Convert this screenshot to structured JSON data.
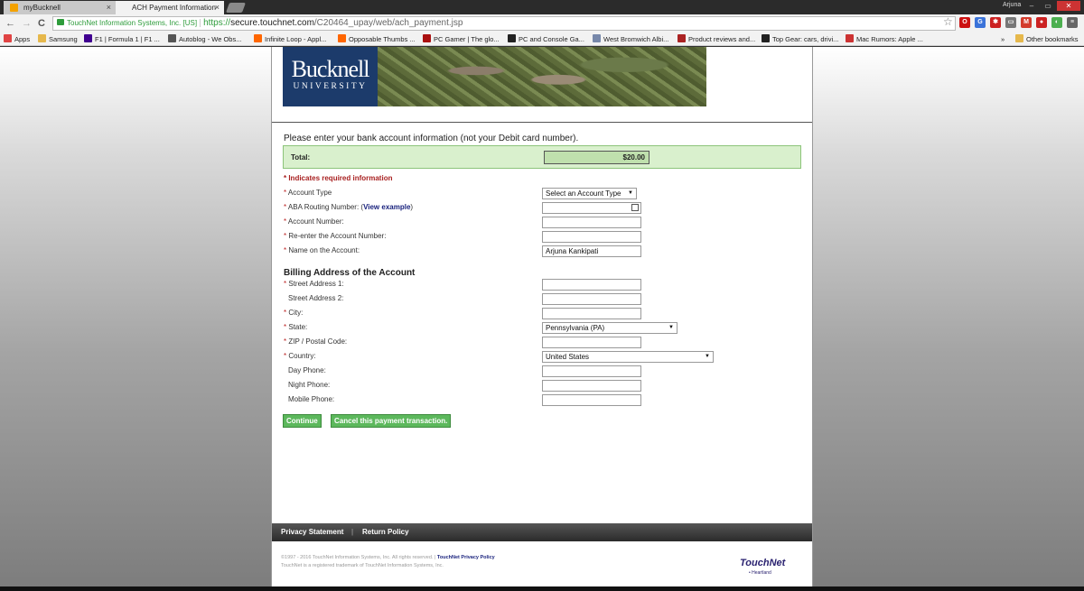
{
  "browser": {
    "tabs": [
      {
        "label": "myBucknell",
        "active": false
      },
      {
        "label": "ACH Payment Information",
        "active": true
      }
    ],
    "tab_close_glyph": "×",
    "user": "Arjuna",
    "window_controls": [
      "–",
      "▭",
      "✕"
    ],
    "nav_glyphs": {
      "back": "←",
      "forward": "→",
      "reload": "C"
    },
    "ev_cert": "TouchNet Information Systems, Inc. [US]",
    "url_scheme": "https://",
    "url_host": "secure.touchnet.com",
    "url_path": "/C20464_upay/web/ach_payment.jsp",
    "star_glyph": "☆",
    "extensions": [
      {
        "icon": "opera-icon",
        "color": "#cc1111",
        "glyph": "O"
      },
      {
        "icon": "translate-icon",
        "color": "#3b73d9",
        "glyph": "G"
      },
      {
        "icon": "lastpass-icon",
        "color": "#cc2222",
        "glyph": "✱"
      },
      {
        "icon": "cast-icon",
        "color": "#777777",
        "glyph": "▭"
      },
      {
        "icon": "gmail-icon",
        "color": "#d33b2c",
        "glyph": "M"
      },
      {
        "icon": "chrome-remote-icon",
        "color": "#cc2222",
        "glyph": "●"
      },
      {
        "icon": "pushbullet-icon",
        "color": "#4caf50",
        "glyph": "◐"
      },
      {
        "icon": "menu-icon",
        "color": "#666666",
        "glyph": "≡"
      }
    ],
    "bookmarks": [
      {
        "label": "Apps",
        "color": "#e04444"
      },
      {
        "label": "Samsung",
        "color": "#e6b84c"
      },
      {
        "label": "F1 | Formula 1 | F1 ...",
        "color": "#400090"
      },
      {
        "label": "Autoblog - We Obs...",
        "color": "#555555"
      },
      {
        "label": "Infinite Loop - Appl...",
        "color": "#ff6600"
      },
      {
        "label": "Opposable Thumbs ...",
        "color": "#ff6600"
      },
      {
        "label": "PC Gamer | The glo...",
        "color": "#aa1111"
      },
      {
        "label": "PC and Console Ga...",
        "color": "#222222"
      },
      {
        "label": "West Bromwich Albi...",
        "color": "#7788aa"
      },
      {
        "label": "Product reviews and...",
        "color": "#aa2222"
      },
      {
        "label": "Top Gear: cars, drivi...",
        "color": "#222222"
      },
      {
        "label": "Mac Rumors: Apple ...",
        "color": "#cc3333"
      }
    ],
    "bookmarks_more": "»",
    "other_bookmarks": "Other bookmarks"
  },
  "banner": {
    "logo_line1": "Bucknell",
    "logo_line2": "UNIVERSITY"
  },
  "form": {
    "intro": "Please enter your bank account information (not your Debit card number).",
    "total_label": "Total:",
    "total_value": "$20.00",
    "required_note": "* Indicates required information",
    "required_mark": "*",
    "account_type_label": "Account Type",
    "account_type_value": "Select an Account Type",
    "routing_label": "ABA Routing Number:",
    "routing_link": "View example",
    "routing_value": "",
    "account_number_label": "Account Number:",
    "account_number_value": "",
    "reenter_label": "Re-enter the Account Number:",
    "reenter_value": "",
    "name_label": "Name on the Account:",
    "name_value": "Arjuna Kankipati",
    "billing_heading": "Billing Address of the Account",
    "street1_label": "Street Address 1:",
    "street1_value": "",
    "street2_label": "Street Address 2:",
    "street2_value": "",
    "city_label": "City:",
    "city_value": "",
    "state_label": "State:",
    "state_value": "Pennsylvania (PA)",
    "zip_label": "ZIP / Postal Code:",
    "zip_value": "",
    "country_label": "Country:",
    "country_value": "United States",
    "day_phone_label": "Day Phone:",
    "day_phone_value": "",
    "night_phone_label": "Night Phone:",
    "night_phone_value": "",
    "mobile_phone_label": "Mobile Phone:",
    "mobile_phone_value": "",
    "continue_label": "Continue",
    "cancel_label": "Cancel this payment transaction.",
    "select_arrow": "▼"
  },
  "footer": {
    "privacy_statement": "Privacy Statement",
    "separator": "|",
    "return_policy": "Return Policy",
    "copyright": "©1997 - 2016 TouchNet Information Systems, Inc. All rights reserved. |",
    "privacy_policy_link": "TouchNet Privacy Policy",
    "trademark": "TouchNet is a registered trademark of TouchNet Information Systems, Inc.",
    "touchnet_logo": "TouchNet",
    "touchnet_sub": "• Heartland"
  }
}
